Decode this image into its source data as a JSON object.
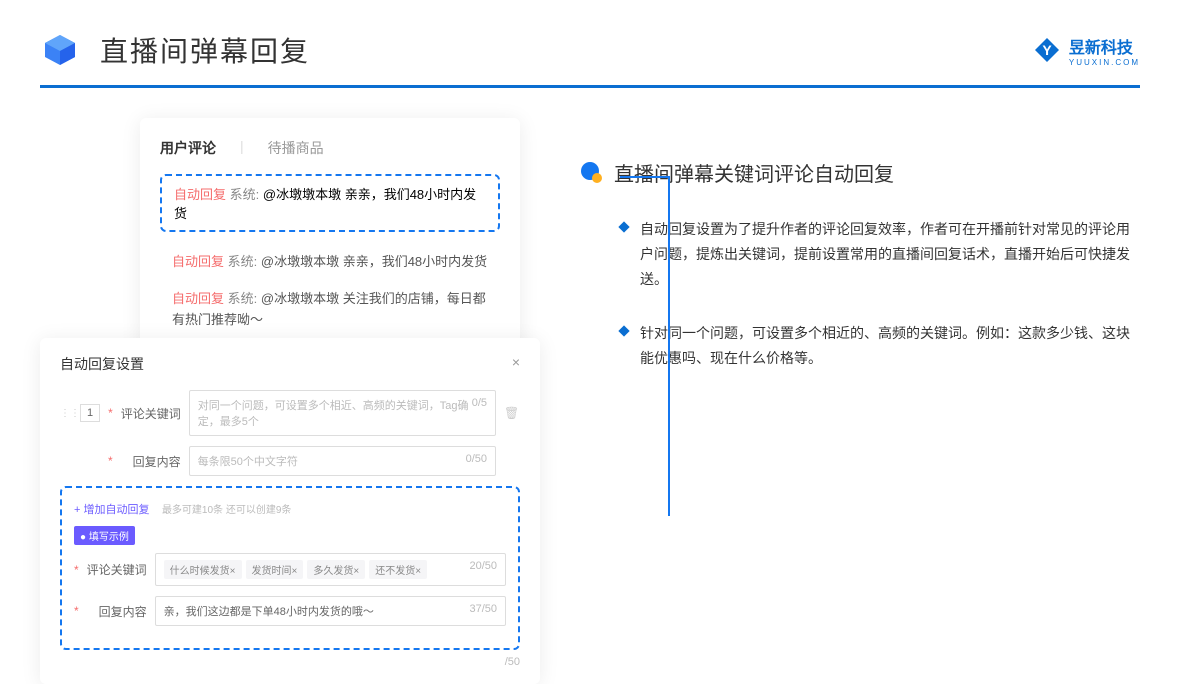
{
  "header": {
    "title": "直播间弹幕回复",
    "logo_main": "昱新科技",
    "logo_sub": "YUUXIN.COM"
  },
  "card1": {
    "tab_active": "用户评论",
    "tab_inactive": "待播商品",
    "comment1_tag": "自动回复",
    "comment1_sys": "系统:",
    "comment1_text": "@冰墩墩本墩 亲亲，我们48小时内发货",
    "comment2_text": "@冰墩墩本墩 亲亲，我们48小时内发货",
    "comment3_text": "@冰墩墩本墩 关注我们的店铺，每日都有热门推荐呦～"
  },
  "card2": {
    "title": "自动回复设置",
    "num": "1",
    "row1_label": "评论关键词",
    "row1_placeholder": "对同一个问题，可设置多个相近、高频的关键词，Tag确定，最多5个",
    "row1_counter": "0/5",
    "row2_label": "回复内容",
    "row2_placeholder": "每条限50个中文字符",
    "row2_counter": "0/50",
    "add_link": "+ 增加自动回复",
    "add_hint": "最多可建10条 还可以创建9条",
    "example_badge": "● 填写示例",
    "ex_row1_label": "评论关键词",
    "chips": [
      "什么时候发货×",
      "发货时间×",
      "多久发货×",
      "还不发货×"
    ],
    "ex_row1_counter": "20/50",
    "ex_row2_label": "回复内容",
    "ex_row2_text": "亲，我们这边都是下单48小时内发货的哦～",
    "ex_row2_counter": "37/50",
    "outer_counter": "/50"
  },
  "right": {
    "title": "直播间弹幕关键词评论自动回复",
    "bullet1": "自动回复设置为了提升作者的评论回复效率，作者可在开播前针对常见的评论用户问题，提炼出关键词，提前设置常用的直播间回复话术，直播开始后可快捷发送。",
    "bullet2": "针对同一个问题，可设置多个相近的、高频的关键词。例如：这款多少钱、这块能优惠吗、现在什么价格等。"
  }
}
